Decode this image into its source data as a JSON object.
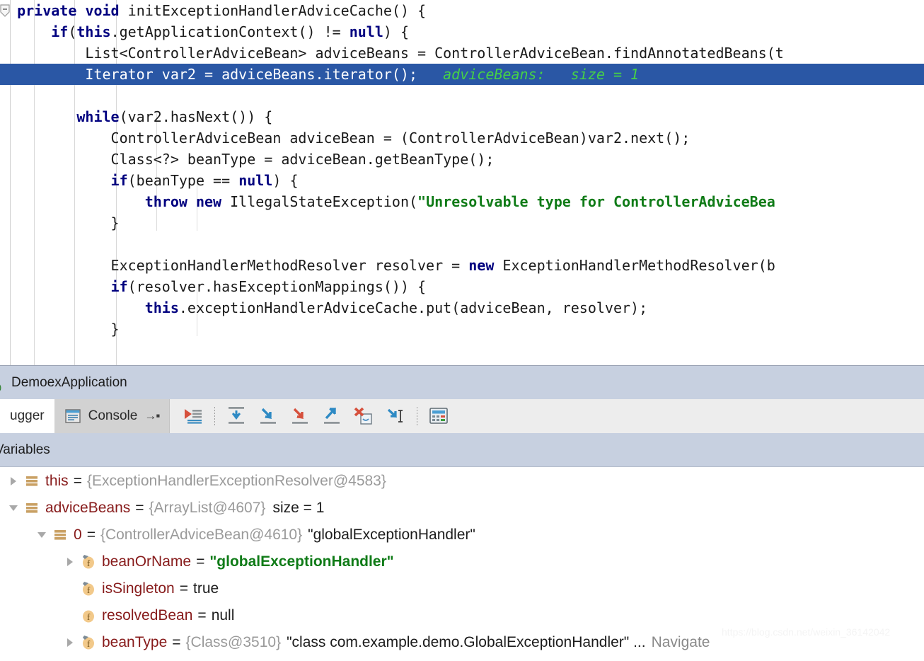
{
  "editor": {
    "fold_icon": "code-fold-collapse-icon",
    "lines": [
      {
        "indent": 0,
        "highlighted": false,
        "tokens": [
          {
            "t": "  ",
            "c": "plain"
          },
          {
            "t": "private",
            "c": "kw"
          },
          {
            "t": " ",
            "c": "plain"
          },
          {
            "t": "void",
            "c": "kw"
          },
          {
            "t": " initExceptionHandlerAdviceCache() {",
            "c": "plain"
          }
        ]
      },
      {
        "indent": 0,
        "highlighted": false,
        "tokens": [
          {
            "t": "      ",
            "c": "plain"
          },
          {
            "t": "if",
            "c": "kw"
          },
          {
            "t": "(",
            "c": "plain"
          },
          {
            "t": "this",
            "c": "kw"
          },
          {
            "t": ".getApplicationContext() != ",
            "c": "plain"
          },
          {
            "t": "null",
            "c": "kw"
          },
          {
            "t": ") {",
            "c": "plain"
          }
        ]
      },
      {
        "indent": 0,
        "highlighted": false,
        "tokens": [
          {
            "t": "          List<ControllerAdviceBean> adviceBeans = ControllerAdviceBean.findAnnotatedBeans(t",
            "c": "plain"
          }
        ]
      },
      {
        "indent": 0,
        "highlighted": true,
        "tokens": [
          {
            "t": "          Iterator var2 = adviceBeans.iterator();",
            "c": "plain"
          },
          {
            "t": "   adviceBeans:   size = 1",
            "c": "hint"
          }
        ]
      },
      {
        "indent": 0,
        "highlighted": false,
        "tokens": [
          {
            "t": "",
            "c": "plain"
          }
        ]
      },
      {
        "indent": 0,
        "highlighted": false,
        "tokens": [
          {
            "t": "         ",
            "c": "plain"
          },
          {
            "t": "while",
            "c": "kw"
          },
          {
            "t": "(var2.hasNext()) {",
            "c": "plain"
          }
        ]
      },
      {
        "indent": 0,
        "highlighted": false,
        "tokens": [
          {
            "t": "             ControllerAdviceBean adviceBean = (ControllerAdviceBean)var2.next();",
            "c": "plain"
          }
        ]
      },
      {
        "indent": 0,
        "highlighted": false,
        "tokens": [
          {
            "t": "             Class<?> beanType = adviceBean.getBeanType();",
            "c": "plain"
          }
        ]
      },
      {
        "indent": 0,
        "highlighted": false,
        "tokens": [
          {
            "t": "             ",
            "c": "plain"
          },
          {
            "t": "if",
            "c": "kw"
          },
          {
            "t": "(beanType == ",
            "c": "plain"
          },
          {
            "t": "null",
            "c": "kw"
          },
          {
            "t": ") {",
            "c": "plain"
          }
        ]
      },
      {
        "indent": 0,
        "highlighted": false,
        "tokens": [
          {
            "t": "                 ",
            "c": "plain"
          },
          {
            "t": "throw",
            "c": "kw"
          },
          {
            "t": " ",
            "c": "plain"
          },
          {
            "t": "new",
            "c": "kw"
          },
          {
            "t": " IllegalStateException(",
            "c": "plain"
          },
          {
            "t": "\"Unresolvable type for ControllerAdviceBea",
            "c": "str"
          }
        ]
      },
      {
        "indent": 0,
        "highlighted": false,
        "tokens": [
          {
            "t": "             }",
            "c": "plain"
          }
        ]
      },
      {
        "indent": 0,
        "highlighted": false,
        "tokens": [
          {
            "t": "",
            "c": "plain"
          }
        ]
      },
      {
        "indent": 0,
        "highlighted": false,
        "tokens": [
          {
            "t": "             ExceptionHandlerMethodResolver resolver = ",
            "c": "plain"
          },
          {
            "t": "new",
            "c": "kw"
          },
          {
            "t": " ExceptionHandlerMethodResolver(b",
            "c": "plain"
          }
        ]
      },
      {
        "indent": 0,
        "highlighted": false,
        "tokens": [
          {
            "t": "             ",
            "c": "plain"
          },
          {
            "t": "if",
            "c": "kw"
          },
          {
            "t": "(resolver.hasExceptionMappings()) {",
            "c": "plain"
          }
        ]
      },
      {
        "indent": 0,
        "highlighted": false,
        "tokens": [
          {
            "t": "                 ",
            "c": "plain"
          },
          {
            "t": "this",
            "c": "kw"
          },
          {
            "t": ".exceptionHandlerAdviceCache.put(adviceBean, resolver);",
            "c": "plain"
          }
        ]
      },
      {
        "indent": 0,
        "highlighted": false,
        "tokens": [
          {
            "t": "             }",
            "c": "plain"
          }
        ]
      }
    ]
  },
  "runbar": {
    "icon": "run-config-green-icon",
    "title": "DemoexApplication"
  },
  "tabs": [
    {
      "label": "ugger",
      "icon": null,
      "active": true,
      "name": "tab-debugger"
    },
    {
      "label": "Console",
      "icon": "console-window-icon",
      "active": false,
      "name": "tab-console",
      "pin": "→▪"
    }
  ],
  "toolbar": {
    "buttons": [
      {
        "name": "show-execution-point-icon",
        "tooltip": "Show Execution Point"
      },
      {
        "sep": true
      },
      {
        "name": "step-over-icon",
        "tooltip": "Step Over"
      },
      {
        "name": "step-into-icon",
        "tooltip": "Step Into"
      },
      {
        "name": "force-step-into-icon",
        "tooltip": "Force Step Into"
      },
      {
        "name": "step-out-icon",
        "tooltip": "Step Out"
      },
      {
        "name": "drop-frame-icon",
        "tooltip": "Drop Frame"
      },
      {
        "name": "run-to-cursor-icon",
        "tooltip": "Run to Cursor"
      },
      {
        "sep": true
      },
      {
        "name": "evaluate-expression-icon",
        "tooltip": "Evaluate Expression"
      }
    ]
  },
  "variables_panel": {
    "header": "Variables",
    "rows": [
      {
        "indent": 0,
        "twisty": "collapsed",
        "icon": "object-node-icon",
        "name": "this",
        "eq": "=",
        "ref": "{ExceptionHandlerExceptionResolver@4583}",
        "value": null,
        "value_kind": null,
        "size": null,
        "nav": null
      },
      {
        "indent": 0,
        "twisty": "expanded",
        "icon": "object-node-icon",
        "name": "adviceBeans",
        "eq": "=",
        "ref": "{ArrayList@4607}",
        "value": null,
        "value_kind": null,
        "size": "size = 1",
        "nav": null
      },
      {
        "indent": 1,
        "twisty": "expanded",
        "icon": "object-node-icon",
        "name": "0",
        "eq": "=",
        "ref": "{ControllerAdviceBean@4610}",
        "value": "\"globalExceptionHandler\"",
        "value_kind": "quoted-plain",
        "size": null,
        "nav": null
      },
      {
        "indent": 2,
        "twisty": "collapsed",
        "icon": "field-final-icon",
        "name": "beanOrName",
        "eq": "=",
        "ref": null,
        "value": "\"globalExceptionHandler\"",
        "value_kind": "string",
        "size": null,
        "nav": null
      },
      {
        "indent": 2,
        "twisty": "none",
        "icon": "field-final-icon",
        "name": "isSingleton",
        "eq": "=",
        "ref": null,
        "value": "true",
        "value_kind": "plain",
        "size": null,
        "nav": null
      },
      {
        "indent": 2,
        "twisty": "none",
        "icon": "field-icon",
        "name": "resolvedBean",
        "eq": "=",
        "ref": null,
        "value": "null",
        "value_kind": "plain",
        "size": null,
        "nav": null
      },
      {
        "indent": 2,
        "twisty": "collapsed",
        "icon": "field-final-icon",
        "name": "beanType",
        "eq": "=",
        "ref": "{Class@3510}",
        "value": "\"class com.example.demo.GlobalExceptionHandler\" ...",
        "value_kind": "quoted-plain",
        "size": null,
        "nav": "Navigate"
      }
    ]
  },
  "watermark": "https://blog.csdn.net/weixin_36142042",
  "colors": {
    "highlight_line": "#2a57a5",
    "keyword": "#00007f",
    "string": "#0f7b17",
    "inline_hint": "#46d246",
    "panel_header": "#c7d0e0",
    "var_name": "#871b1b",
    "var_ref": "#9a9a9a",
    "toolbar_bg": "#ededed",
    "tabrow_bg": "#d2d2d2"
  }
}
